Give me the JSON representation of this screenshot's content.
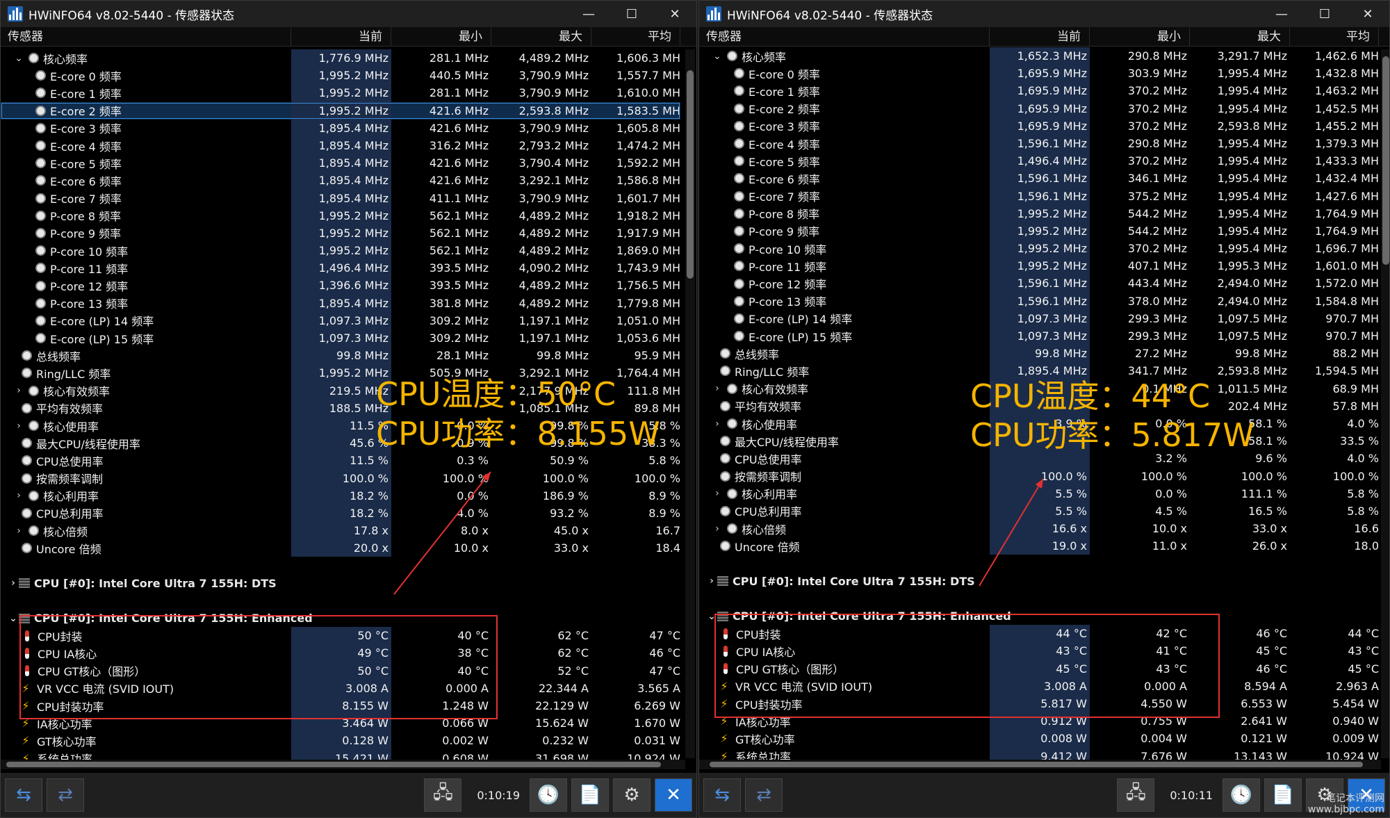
{
  "app_title": "HWiNFO64 v8.02-5440 - 传感器状态",
  "window_controls": {
    "minimize": "—",
    "maximize": "☐",
    "close": "✕"
  },
  "columns": {
    "sensor": "传感器",
    "current": "当前",
    "min": "最小",
    "max": "最大",
    "avg": "平均"
  },
  "left": {
    "rows": [
      {
        "name": "核心频率",
        "kind": "clock",
        "expand": "⌄",
        "indent": 1,
        "cur": "1,776.9 MHz",
        "min": "281.1 MHz",
        "max": "4,489.2 MHz",
        "avg": "1,606.3 MH"
      },
      {
        "name": "E-core 0 频率",
        "kind": "clock",
        "indent": 2,
        "cur": "1,995.2 MHz",
        "min": "440.5 MHz",
        "max": "3,790.9 MHz",
        "avg": "1,557.7 MH"
      },
      {
        "name": "E-core 1 频率",
        "kind": "clock",
        "indent": 2,
        "cur": "1,995.2 MHz",
        "min": "281.1 MHz",
        "max": "3,790.9 MHz",
        "avg": "1,610.0 MH"
      },
      {
        "name": "E-core 2 频率",
        "kind": "clock",
        "indent": 2,
        "sel": true,
        "cur": "1,995.2 MHz",
        "min": "421.6 MHz",
        "max": "2,593.8 MHz",
        "avg": "1,583.5 MH"
      },
      {
        "name": "E-core 3 频率",
        "kind": "clock",
        "indent": 2,
        "cur": "1,895.4 MHz",
        "min": "421.6 MHz",
        "max": "3,790.9 MHz",
        "avg": "1,605.8 MH"
      },
      {
        "name": "E-core 4 频率",
        "kind": "clock",
        "indent": 2,
        "cur": "1,895.4 MHz",
        "min": "316.2 MHz",
        "max": "2,793.2 MHz",
        "avg": "1,474.2 MH"
      },
      {
        "name": "E-core 5 频率",
        "kind": "clock",
        "indent": 2,
        "cur": "1,895.4 MHz",
        "min": "421.6 MHz",
        "max": "3,790.4 MHz",
        "avg": "1,592.2 MH"
      },
      {
        "name": "E-core 6 频率",
        "kind": "clock",
        "indent": 2,
        "cur": "1,895.4 MHz",
        "min": "421.6 MHz",
        "max": "3,292.1 MHz",
        "avg": "1,586.8 MH"
      },
      {
        "name": "E-core 7 频率",
        "kind": "clock",
        "indent": 2,
        "cur": "1,895.4 MHz",
        "min": "411.1 MHz",
        "max": "3,790.9 MHz",
        "avg": "1,601.7 MH"
      },
      {
        "name": "P-core 8 频率",
        "kind": "clock",
        "indent": 2,
        "cur": "1,995.2 MHz",
        "min": "562.1 MHz",
        "max": "4,489.2 MHz",
        "avg": "1,918.2 MH"
      },
      {
        "name": "P-core 9 频率",
        "kind": "clock",
        "indent": 2,
        "cur": "1,995.2 MHz",
        "min": "562.1 MHz",
        "max": "4,489.2 MHz",
        "avg": "1,917.9 MH"
      },
      {
        "name": "P-core 10 频率",
        "kind": "clock",
        "indent": 2,
        "cur": "1,995.2 MHz",
        "min": "562.1 MHz",
        "max": "4,489.2 MHz",
        "avg": "1,869.0 MH"
      },
      {
        "name": "P-core 11 频率",
        "kind": "clock",
        "indent": 2,
        "cur": "1,496.4 MHz",
        "min": "393.5 MHz",
        "max": "4,090.2 MHz",
        "avg": "1,743.9 MH"
      },
      {
        "name": "P-core 12 频率",
        "kind": "clock",
        "indent": 2,
        "cur": "1,396.6 MHz",
        "min": "393.5 MHz",
        "max": "4,489.2 MHz",
        "avg": "1,756.5 MH"
      },
      {
        "name": "P-core 13 频率",
        "kind": "clock",
        "indent": 2,
        "cur": "1,895.4 MHz",
        "min": "381.8 MHz",
        "max": "4,489.2 MHz",
        "avg": "1,779.8 MH"
      },
      {
        "name": "E-core (LP) 14 频率",
        "kind": "clock",
        "indent": 2,
        "cur": "1,097.3 MHz",
        "min": "309.2 MHz",
        "max": "1,197.1 MHz",
        "avg": "1,051.0 MH"
      },
      {
        "name": "E-core (LP) 15 频率",
        "kind": "clock",
        "indent": 2,
        "cur": "1,097.3 MHz",
        "min": "309.2 MHz",
        "max": "1,197.1 MHz",
        "avg": "1,053.6 MH"
      },
      {
        "name": "总线频率",
        "kind": "clock",
        "indent": 0,
        "cur": "99.8 MHz",
        "min": "28.1 MHz",
        "max": "99.8 MHz",
        "avg": "95.9 MH"
      },
      {
        "name": "Ring/LLC 频率",
        "kind": "clock",
        "indent": 0,
        "cur": "1,995.2 MHz",
        "min": "505.9 MHz",
        "max": "3,292.1 MHz",
        "avg": "1,764.4 MH"
      },
      {
        "name": "核心有效频率",
        "kind": "clock",
        "expand": "›",
        "indent": 1,
        "cur": "219.5 MHz",
        "min": "",
        "max": "2,177.9 MHz",
        "avg": "111.8 MH"
      },
      {
        "name": "平均有效频率",
        "kind": "clock",
        "indent": 0,
        "cur": "188.5 MHz",
        "min": "",
        "max": "1,085.1 MHz",
        "avg": "89.8 MH"
      },
      {
        "name": "核心使用率",
        "kind": "clock",
        "expand": "›",
        "indent": 1,
        "cur": "11.5 %",
        "min": "0.0 %",
        "max": "99.8 %",
        "avg": "5.8 %"
      },
      {
        "name": "最大CPU/线程使用率",
        "kind": "clock",
        "indent": 0,
        "cur": "45.6 %",
        "min": "0.9 %",
        "max": "99.8 %",
        "avg": "38.3 %"
      },
      {
        "name": "CPU总使用率",
        "kind": "clock",
        "indent": 0,
        "cur": "11.5 %",
        "min": "0.3 %",
        "max": "50.9 %",
        "avg": "5.8 %"
      },
      {
        "name": "按需频率调制",
        "kind": "clock",
        "indent": 0,
        "cur": "100.0 %",
        "min": "100.0 %",
        "max": "100.0 %",
        "avg": "100.0 %"
      },
      {
        "name": "核心利用率",
        "kind": "clock",
        "expand": "›",
        "indent": 1,
        "cur": "18.2 %",
        "min": "0.0 %",
        "max": "186.9 %",
        "avg": "8.9 %"
      },
      {
        "name": "CPU总利用率",
        "kind": "clock",
        "indent": 0,
        "cur": "18.2 %",
        "min": "4.0 %",
        "max": "93.2 %",
        "avg": "8.9 %"
      },
      {
        "name": "核心倍频",
        "kind": "clock",
        "expand": "›",
        "indent": 1,
        "cur": "17.8 x",
        "min": "8.0 x",
        "max": "45.0 x",
        "avg": "16.7"
      },
      {
        "name": "Uncore 倍频",
        "kind": "clock",
        "indent": 0,
        "cur": "20.0 x",
        "min": "10.0 x",
        "max": "33.0 x",
        "avg": "18.4"
      },
      {
        "kind": "blank"
      },
      {
        "name": "CPU [#0]: Intel Core Ultra 7 155H: DTS",
        "kind": "group",
        "expand": "›"
      },
      {
        "kind": "blank"
      },
      {
        "name": "CPU [#0]: Intel Core Ultra 7 155H: Enhanced",
        "kind": "group",
        "expand": "⌄"
      },
      {
        "name": "CPU封装",
        "kind": "therm",
        "cur": "50 °C",
        "min": "40 °C",
        "max": "62 °C",
        "avg": "47 °C"
      },
      {
        "name": "CPU IA核心",
        "kind": "therm",
        "cur": "49 °C",
        "min": "38 °C",
        "max": "62 °C",
        "avg": "46 °C"
      },
      {
        "name": "CPU GT核心（图形）",
        "kind": "therm",
        "cur": "50 °C",
        "min": "40 °C",
        "max": "52 °C",
        "avg": "47 °C"
      },
      {
        "name": "VR VCC 电流 (SVID IOUT)",
        "kind": "bolt",
        "cur": "3.008 A",
        "min": "0.000 A",
        "max": "22.344 A",
        "avg": "3.565 A"
      },
      {
        "name": "CPU封装功率",
        "kind": "bolt",
        "cur": "8.155 W",
        "min": "1.248 W",
        "max": "22.129 W",
        "avg": "6.269 W"
      },
      {
        "name": "IA核心功率",
        "kind": "bolt",
        "cur": "3.464 W",
        "min": "0.066 W",
        "max": "15.624 W",
        "avg": "1.670 W"
      },
      {
        "name": "GT核心功率",
        "kind": "bolt",
        "cur": "0.128 W",
        "min": "0.002 W",
        "max": "0.232 W",
        "avg": "0.031 W"
      },
      {
        "name": "系统总功率",
        "kind": "bolt",
        "cur": "15.421 W",
        "min": "0.608 W",
        "max": "31.698 W",
        "avg": "10.924 W"
      }
    ],
    "timer": "0:10:19",
    "anno_temp": "CPU温度：50°C",
    "anno_power": "CPU功率：8.155W"
  },
  "right": {
    "rows": [
      {
        "name": "核心频率",
        "kind": "clock",
        "expand": "⌄",
        "indent": 1,
        "cur": "1,652.3 MHz",
        "min": "290.8 MHz",
        "max": "3,291.7 MHz",
        "avg": "1,462.6 MH"
      },
      {
        "name": "E-core 0 频率",
        "kind": "clock",
        "indent": 2,
        "cur": "1,695.9 MHz",
        "min": "303.9 MHz",
        "max": "1,995.4 MHz",
        "avg": "1,432.8 MH"
      },
      {
        "name": "E-core 1 频率",
        "kind": "clock",
        "indent": 2,
        "cur": "1,695.9 MHz",
        "min": "370.2 MHz",
        "max": "1,995.4 MHz",
        "avg": "1,463.2 MH"
      },
      {
        "name": "E-core 2 频率",
        "kind": "clock",
        "indent": 2,
        "cur": "1,695.9 MHz",
        "min": "370.2 MHz",
        "max": "1,995.4 MHz",
        "avg": "1,452.5 MH"
      },
      {
        "name": "E-core 3 频率",
        "kind": "clock",
        "indent": 2,
        "cur": "1,695.9 MHz",
        "min": "370.2 MHz",
        "max": "2,593.8 MHz",
        "avg": "1,455.2 MH"
      },
      {
        "name": "E-core 4 频率",
        "kind": "clock",
        "indent": 2,
        "cur": "1,596.1 MHz",
        "min": "290.8 MHz",
        "max": "1,995.4 MHz",
        "avg": "1,379.3 MH"
      },
      {
        "name": "E-core 5 频率",
        "kind": "clock",
        "indent": 2,
        "cur": "1,496.4 MHz",
        "min": "370.2 MHz",
        "max": "1,995.4 MHz",
        "avg": "1,433.3 MH"
      },
      {
        "name": "E-core 6 频率",
        "kind": "clock",
        "indent": 2,
        "cur": "1,596.1 MHz",
        "min": "346.1 MHz",
        "max": "1,995.4 MHz",
        "avg": "1,432.4 MH"
      },
      {
        "name": "E-core 7 频率",
        "kind": "clock",
        "indent": 2,
        "cur": "1,596.1 MHz",
        "min": "375.2 MHz",
        "max": "1,995.4 MHz",
        "avg": "1,427.6 MH"
      },
      {
        "name": "P-core 8 频率",
        "kind": "clock",
        "indent": 2,
        "cur": "1,995.2 MHz",
        "min": "544.2 MHz",
        "max": "1,995.4 MHz",
        "avg": "1,764.9 MH"
      },
      {
        "name": "P-core 9 频率",
        "kind": "clock",
        "indent": 2,
        "cur": "1,995.2 MHz",
        "min": "544.2 MHz",
        "max": "1,995.4 MHz",
        "avg": "1,764.9 MH"
      },
      {
        "name": "P-core 10 频率",
        "kind": "clock",
        "indent": 2,
        "cur": "1,995.2 MHz",
        "min": "370.2 MHz",
        "max": "1,995.4 MHz",
        "avg": "1,696.7 MH"
      },
      {
        "name": "P-core 11 频率",
        "kind": "clock",
        "indent": 2,
        "cur": "1,995.2 MHz",
        "min": "407.1 MHz",
        "max": "1,995.3 MHz",
        "avg": "1,601.0 MH"
      },
      {
        "name": "P-core 12 频率",
        "kind": "clock",
        "indent": 2,
        "cur": "1,596.1 MHz",
        "min": "443.4 MHz",
        "max": "2,494.0 MHz",
        "avg": "1,572.0 MH"
      },
      {
        "name": "P-core 13 频率",
        "kind": "clock",
        "indent": 2,
        "cur": "1,596.1 MHz",
        "min": "378.0 MHz",
        "max": "2,494.0 MHz",
        "avg": "1,584.8 MH"
      },
      {
        "name": "E-core (LP) 14 频率",
        "kind": "clock",
        "indent": 2,
        "cur": "1,097.3 MHz",
        "min": "299.3 MHz",
        "max": "1,097.5 MHz",
        "avg": "970.7 MH"
      },
      {
        "name": "E-core (LP) 15 频率",
        "kind": "clock",
        "indent": 2,
        "cur": "1,097.3 MHz",
        "min": "299.3 MHz",
        "max": "1,097.5 MHz",
        "avg": "970.7 MH"
      },
      {
        "name": "总线频率",
        "kind": "clock",
        "indent": 0,
        "cur": "99.8 MHz",
        "min": "27.2 MHz",
        "max": "99.8 MHz",
        "avg": "88.2 MH"
      },
      {
        "name": "Ring/LLC 频率",
        "kind": "clock",
        "indent": 0,
        "cur": "1,895.4 MHz",
        "min": "341.7 MHz",
        "max": "2,593.8 MHz",
        "avg": "1,594.5 MH"
      },
      {
        "name": "核心有效频率",
        "kind": "clock",
        "expand": "›",
        "indent": 1,
        "cur": "",
        "min": "0.1 MHz",
        "max": "1,011.5 MHz",
        "avg": "68.9 MH"
      },
      {
        "name": "平均有效频率",
        "kind": "clock",
        "indent": 0,
        "cur": "",
        "min": "",
        "max": "202.4 MHz",
        "avg": "57.8 MH"
      },
      {
        "name": "核心使用率",
        "kind": "clock",
        "expand": "›",
        "indent": 1,
        "cur": "3.9 %",
        "min": "0.0 %",
        "max": "58.1 %",
        "avg": "4.0 %"
      },
      {
        "name": "最大CPU/线程使用率",
        "kind": "clock",
        "indent": 0,
        "cur": "",
        "min": "",
        "max": "58.1 %",
        "avg": "33.5 %"
      },
      {
        "name": "CPU总使用率",
        "kind": "clock",
        "indent": 0,
        "cur": "",
        "min": "3.2 %",
        "max": "9.6 %",
        "avg": "4.0 %"
      },
      {
        "name": "按需频率调制",
        "kind": "clock",
        "indent": 0,
        "cur": "100.0 %",
        "min": "100.0 %",
        "max": "100.0 %",
        "avg": "100.0 %"
      },
      {
        "name": "核心利用率",
        "kind": "clock",
        "expand": "›",
        "indent": 1,
        "cur": "5.5 %",
        "min": "0.0 %",
        "max": "111.1 %",
        "avg": "5.8 %"
      },
      {
        "name": "CPU总利用率",
        "kind": "clock",
        "indent": 0,
        "cur": "5.5 %",
        "min": "4.5 %",
        "max": "16.5 %",
        "avg": "5.8 %"
      },
      {
        "name": "核心倍频",
        "kind": "clock",
        "expand": "›",
        "indent": 1,
        "cur": "16.6 x",
        "min": "10.0 x",
        "max": "33.0 x",
        "avg": "16.6"
      },
      {
        "name": "Uncore 倍频",
        "kind": "clock",
        "indent": 0,
        "cur": "19.0 x",
        "min": "11.0 x",
        "max": "26.0 x",
        "avg": "18.0"
      },
      {
        "kind": "blank"
      },
      {
        "name": "CPU [#0]: Intel Core Ultra 7 155H: DTS",
        "kind": "group",
        "expand": "›"
      },
      {
        "kind": "blank"
      },
      {
        "name": "CPU [#0]: Intel Core Ultra 7 155H: Enhanced",
        "kind": "group",
        "expand": "⌄"
      },
      {
        "name": "CPU封装",
        "kind": "therm",
        "cur": "44 °C",
        "min": "42 °C",
        "max": "46 °C",
        "avg": "44 °C"
      },
      {
        "name": "CPU IA核心",
        "kind": "therm",
        "cur": "43 °C",
        "min": "41 °C",
        "max": "45 °C",
        "avg": "43 °C"
      },
      {
        "name": "CPU GT核心（图形）",
        "kind": "therm",
        "cur": "45 °C",
        "min": "43 °C",
        "max": "46 °C",
        "avg": "45 °C"
      },
      {
        "name": "VR VCC 电流 (SVID IOUT)",
        "kind": "bolt",
        "cur": "3.008 A",
        "min": "0.000 A",
        "max": "8.594 A",
        "avg": "2.963 A"
      },
      {
        "name": "CPU封装功率",
        "kind": "bolt",
        "cur": "5.817 W",
        "min": "4.550 W",
        "max": "6.553 W",
        "avg": "5.454 W"
      },
      {
        "name": "IA核心功率",
        "kind": "bolt",
        "cur": "0.912 W",
        "min": "0.755 W",
        "max": "2.641 W",
        "avg": "0.940 W"
      },
      {
        "name": "GT核心功率",
        "kind": "bolt",
        "cur": "0.008 W",
        "min": "0.004 W",
        "max": "0.121 W",
        "avg": "0.009 W"
      },
      {
        "name": "系统总功率",
        "kind": "bolt",
        "cur": "9.412 W",
        "min": "7.676 W",
        "max": "13.143 W",
        "avg": "10.924 W"
      }
    ],
    "timer": "0:10:11",
    "anno_temp": "CPU温度：44°C",
    "anno_power": "CPU功率：5.817W"
  },
  "toolbar_icons": [
    "arrows-expand-icon",
    "arrows-collapse-icon",
    "network-icon",
    "clock-icon",
    "report-icon",
    "settings-icon",
    "close-icon"
  ],
  "watermark": {
    "line1": "笔记本评测网",
    "line2": "www.bjbpc.com"
  },
  "colors": {
    "annotation": "#f5b400",
    "highlight_box": "#e53030",
    "selection": "#3a8ad8"
  }
}
